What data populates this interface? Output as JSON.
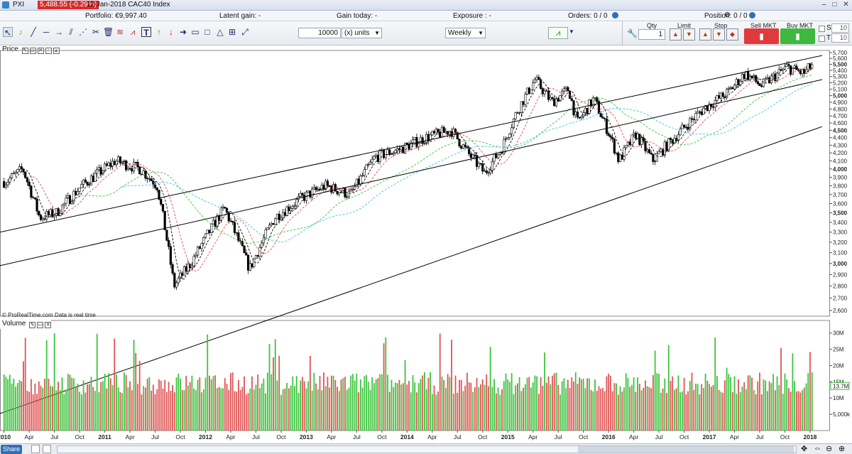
{
  "titlebar": {
    "app": "PXI",
    "price_badge": "5,488.55 (-0.29%)",
    "title": "11-Jan-2018 CAC40 Index"
  },
  "infobar": {
    "portfolio": "Portfolio: €9,997.40",
    "latent_gain": "Latent gain: -",
    "gain_today": "Gain today: -",
    "exposure": "Exposure : -",
    "orders": "Orders: 0 / 0",
    "position": "Position: 0 / 0"
  },
  "toolbar": {
    "quantity_value": "10000",
    "units_select": "(x) units",
    "period_select": "Weekly",
    "qty_label": "Qty",
    "qty_value": "1",
    "limit_label": "Limit",
    "stop_label": "Stop",
    "sell_label": "Sell MKT",
    "buy_label": "Buy MKT",
    "s_label": "S",
    "t_label": "T",
    "s_value": "10",
    "t_value": "10"
  },
  "price_panel": {
    "label": "Price"
  },
  "volume_panel": {
    "label": "Volume"
  },
  "copyright": "© ProRealTime.com  Data is real time",
  "bottom": {
    "share": "Share"
  },
  "colors": {
    "up_volume": "#3cc43c",
    "down_volume": "#e05454",
    "accent": "#2f6fb6"
  },
  "chart_data": [
    {
      "type": "candlestick",
      "title": "",
      "x_ticks": [
        "2010",
        "Apr",
        "Jul",
        "Oct",
        "2011",
        "Apr",
        "Jul",
        "Oct",
        "2012",
        "Apr",
        "Jul",
        "Oct",
        "2013",
        "Apr",
        "Jul",
        "Oct",
        "2014",
        "Apr",
        "Jul",
        "Oct",
        "2015",
        "Apr",
        "Jul",
        "Oct",
        "2016",
        "Apr",
        "Jul",
        "Oct",
        "2017",
        "Apr",
        "Jul",
        "Oct",
        "2018"
      ],
      "y_ticks": [
        "5,700",
        "5,600",
        "5,500",
        "5,400",
        "5,300",
        "5,200",
        "5,100",
        "5,000",
        "4,900",
        "4,800",
        "4,700",
        "4,600",
        "4,500",
        "4,400",
        "4,300",
        "4,200",
        "4,100",
        "4,000",
        "3,900",
        "3,800",
        "3,700",
        "3,600",
        "3,500",
        "3,400",
        "3,300",
        "3,200",
        "3,100",
        "3,000",
        "2,900",
        "2,800",
        "2,700",
        "2,600"
      ],
      "ylim": [
        2600,
        5700
      ],
      "y_scale": "log",
      "approx_weekly_close_anchors": [
        {
          "x": "2010-01",
          "y": 3850
        },
        {
          "x": "2010-03",
          "y": 4000
        },
        {
          "x": "2010-05",
          "y": 3450
        },
        {
          "x": "2010-07",
          "y": 3500
        },
        {
          "x": "2010-10",
          "y": 3800
        },
        {
          "x": "2011-02",
          "y": 4100
        },
        {
          "x": "2011-05",
          "y": 4000
        },
        {
          "x": "2011-07",
          "y": 3800
        },
        {
          "x": "2011-09",
          "y": 2800
        },
        {
          "x": "2011-11",
          "y": 3000
        },
        {
          "x": "2012-03",
          "y": 3550
        },
        {
          "x": "2012-06",
          "y": 2950
        },
        {
          "x": "2012-09",
          "y": 3450
        },
        {
          "x": "2012-12",
          "y": 3650
        },
        {
          "x": "2013-03",
          "y": 3800
        },
        {
          "x": "2013-06",
          "y": 3700
        },
        {
          "x": "2013-09",
          "y": 4150
        },
        {
          "x": "2013-12",
          "y": 4250
        },
        {
          "x": "2014-03",
          "y": 4400
        },
        {
          "x": "2014-06",
          "y": 4500
        },
        {
          "x": "2014-08",
          "y": 4200
        },
        {
          "x": "2014-10",
          "y": 3950
        },
        {
          "x": "2014-12",
          "y": 4250
        },
        {
          "x": "2015-02",
          "y": 4800
        },
        {
          "x": "2015-04",
          "y": 5250
        },
        {
          "x": "2015-06",
          "y": 4900
        },
        {
          "x": "2015-08",
          "y": 5100
        },
        {
          "x": "2015-09",
          "y": 4600
        },
        {
          "x": "2015-11",
          "y": 4950
        },
        {
          "x": "2016-01",
          "y": 4400
        },
        {
          "x": "2016-02",
          "y": 4100
        },
        {
          "x": "2016-04",
          "y": 4450
        },
        {
          "x": "2016-06",
          "y": 4100
        },
        {
          "x": "2016-09",
          "y": 4450
        },
        {
          "x": "2016-12",
          "y": 4800
        },
        {
          "x": "2017-03",
          "y": 5050
        },
        {
          "x": "2017-05",
          "y": 5350
        },
        {
          "x": "2017-07",
          "y": 5150
        },
        {
          "x": "2017-10",
          "y": 5450
        },
        {
          "x": "2017-12",
          "y": 5350
        },
        {
          "x": "2018-01",
          "y": 5488.55
        }
      ],
      "overlays": [
        "moving averages (black dashed, red dashed, green dashed, cyan dashed)",
        "parallel trend channel lines (black)"
      ]
    },
    {
      "type": "bar",
      "title": "",
      "y_ticks": [
        "30M",
        "25M",
        "20M",
        "15M",
        "10M",
        "5,000k"
      ],
      "current_value_label": "13.7M",
      "ylim": [
        0,
        33000000
      ],
      "approx_values": "weekly volume between about 6M and 31M, mostly 12M to 18M"
    }
  ]
}
